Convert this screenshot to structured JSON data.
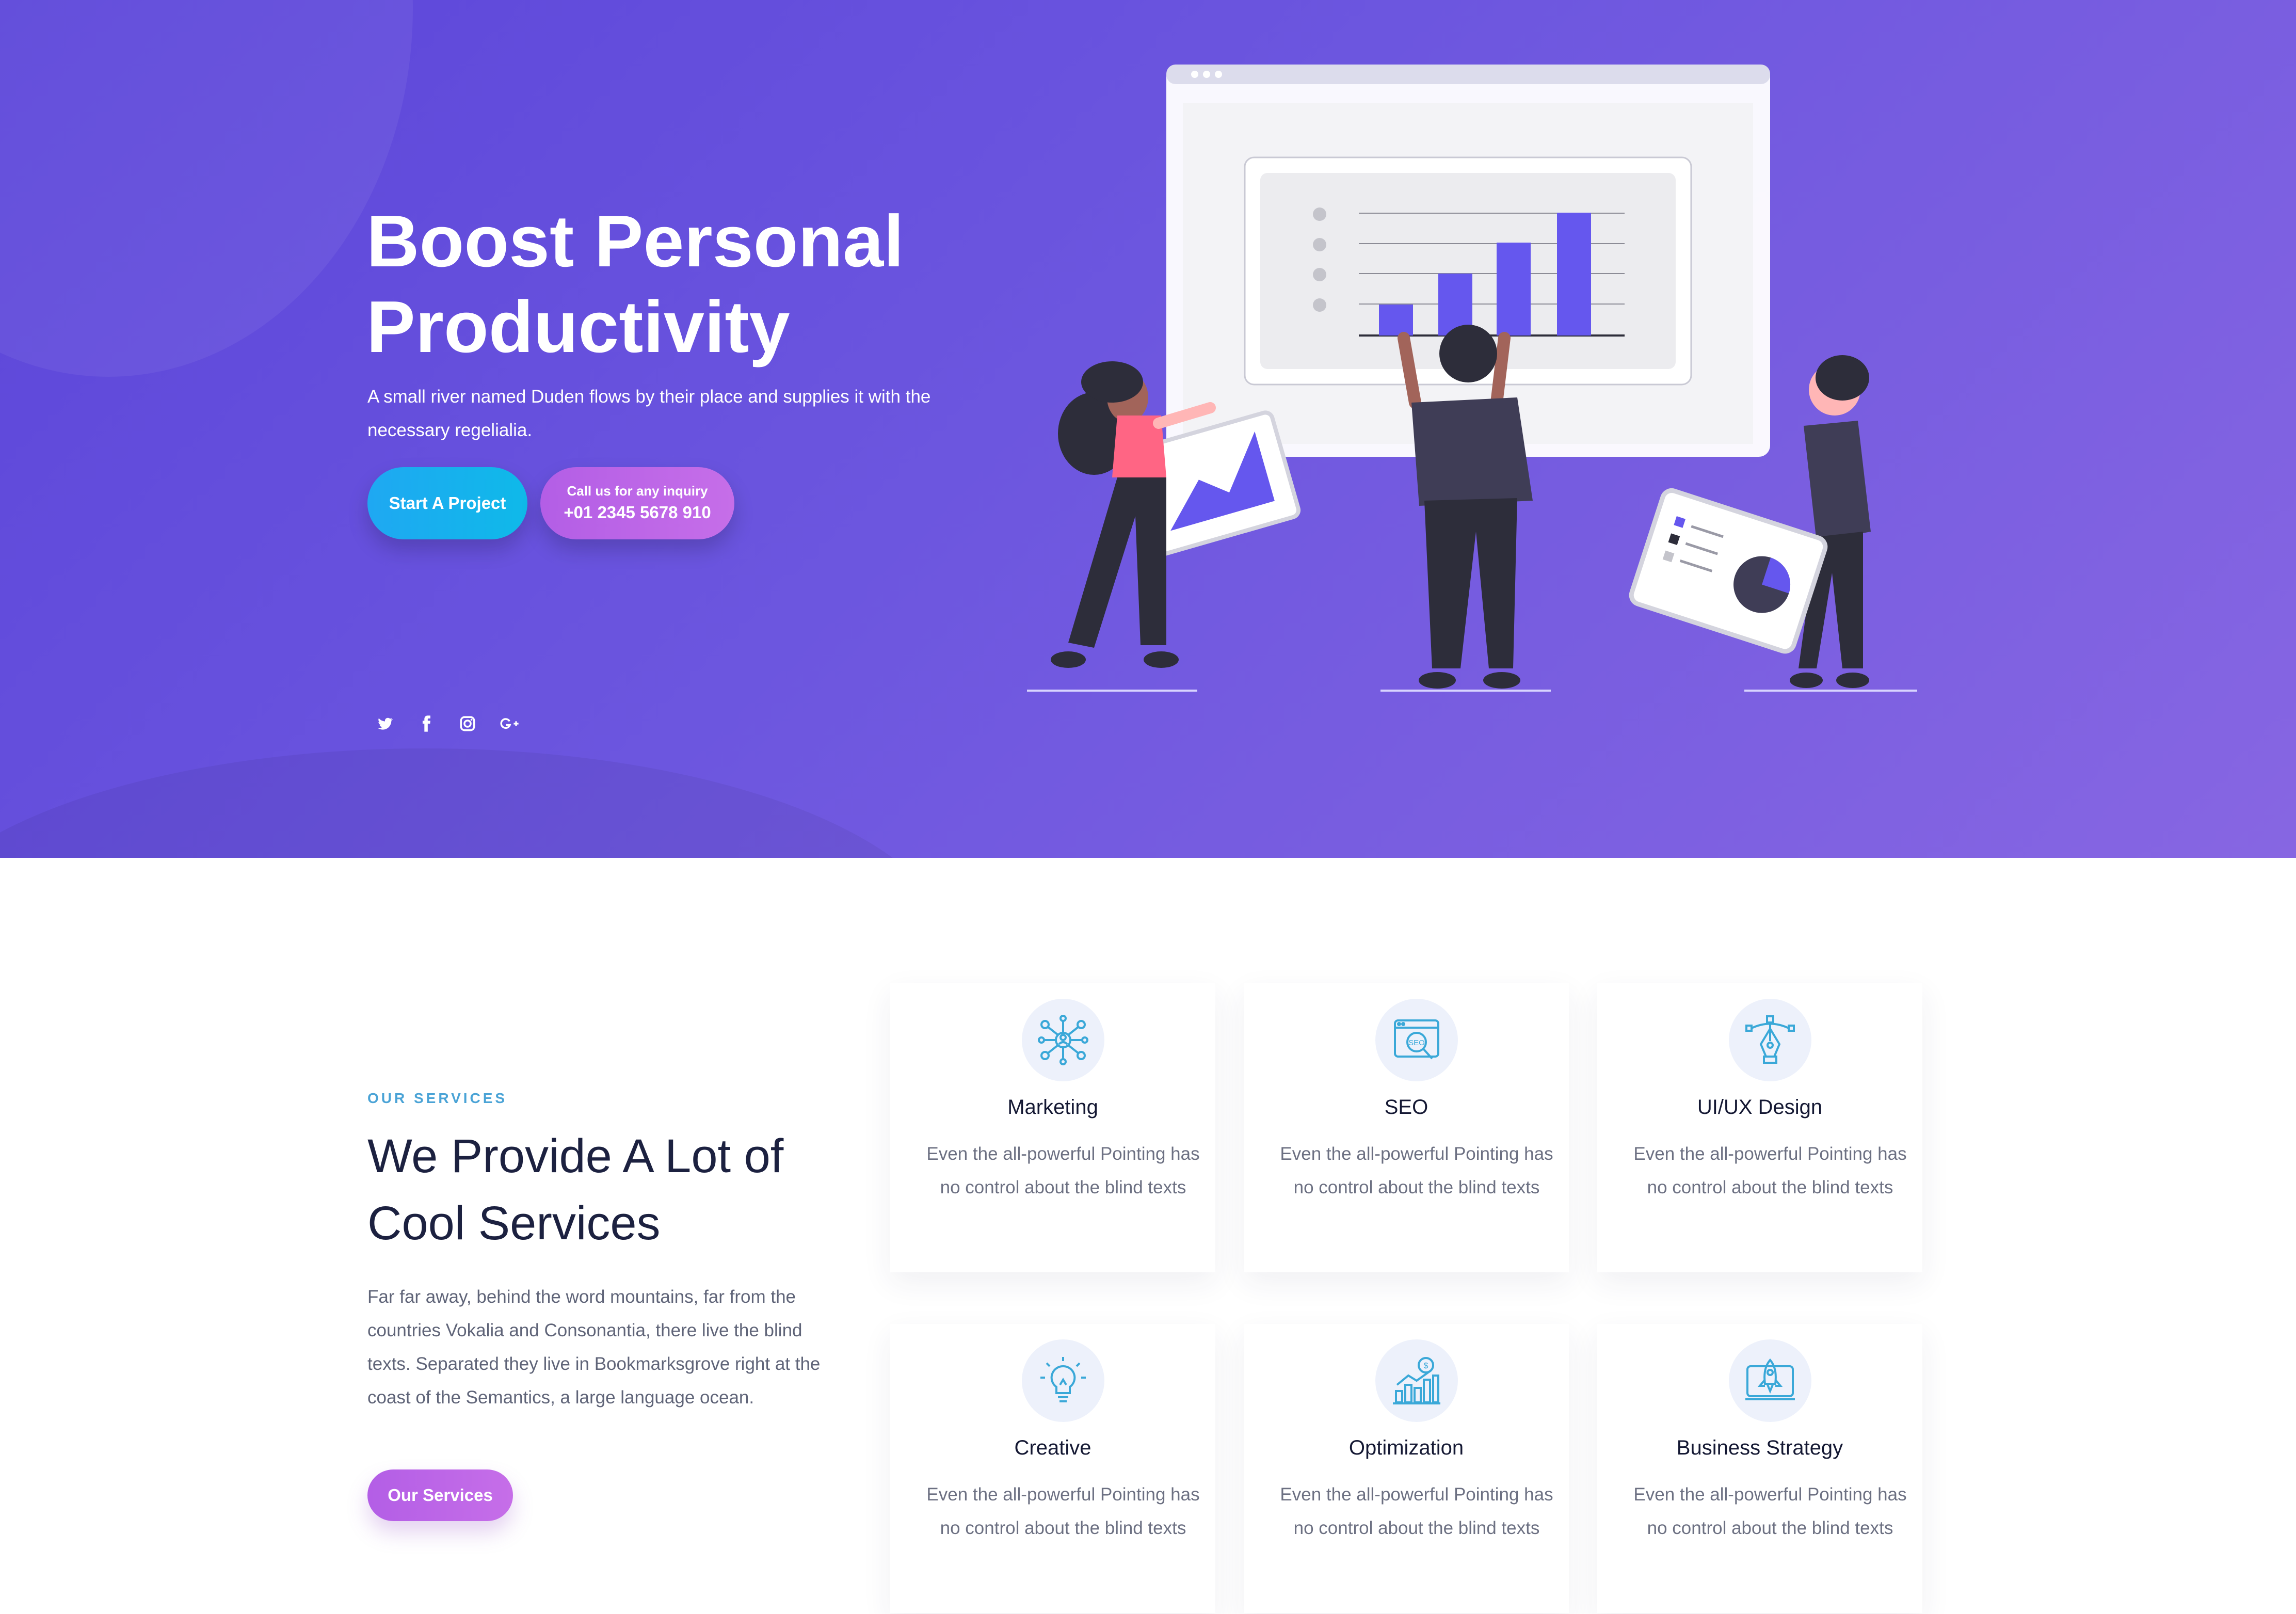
{
  "hero": {
    "title_line1": "Boost Personal",
    "title_line2": "Productivity",
    "subtitle": "A small river named Duden flows by their place and supplies it with the necessary regelialia.",
    "start_button": "Start A Project",
    "call_line1": "Call us for any inquiry",
    "call_line2": "+01 2345 5678 910",
    "social": [
      "twitter-icon",
      "facebook-icon",
      "instagram-icon",
      "google-plus-icon"
    ]
  },
  "services": {
    "eyebrow": "OUR SERVICES",
    "title_line1": "We Provide A Lot of",
    "title_line2": "Cool Services",
    "description": "Far far away, behind the word mountains, far from the countries Vokalia and Consonantia, there live the blind texts. Separated they live in Bookmarksgrove right at the coast of the Semantics, a large language ocean.",
    "button": "Our Services",
    "items": [
      {
        "title": "Marketing",
        "text": "Even the all-powerful Pointing has no control about the blind texts",
        "icon": "network-icon"
      },
      {
        "title": "SEO",
        "text": "Even the all-powerful Pointing has no control about the blind texts",
        "icon": "seo-search-icon"
      },
      {
        "title": "UI/UX Design",
        "text": "Even the all-powerful Pointing has no control about the blind texts",
        "icon": "pen-tool-icon"
      },
      {
        "title": "Creative",
        "text": "Even the all-powerful Pointing has no control about the blind texts",
        "icon": "lightbulb-icon"
      },
      {
        "title": "Optimization",
        "text": "Even the all-powerful Pointing has no control about the blind texts",
        "icon": "growth-chart-icon"
      },
      {
        "title": "Business Strategy",
        "text": "Even the all-powerful Pointing has no control about the blind texts",
        "icon": "rocket-icon"
      }
    ]
  },
  "colors": {
    "hero_start": "#5b45d9",
    "hero_end": "#8766e2",
    "accent_purple": "#c66ee8",
    "accent_blue": "#1fa8f2",
    "bar_color": "#6557ee"
  }
}
